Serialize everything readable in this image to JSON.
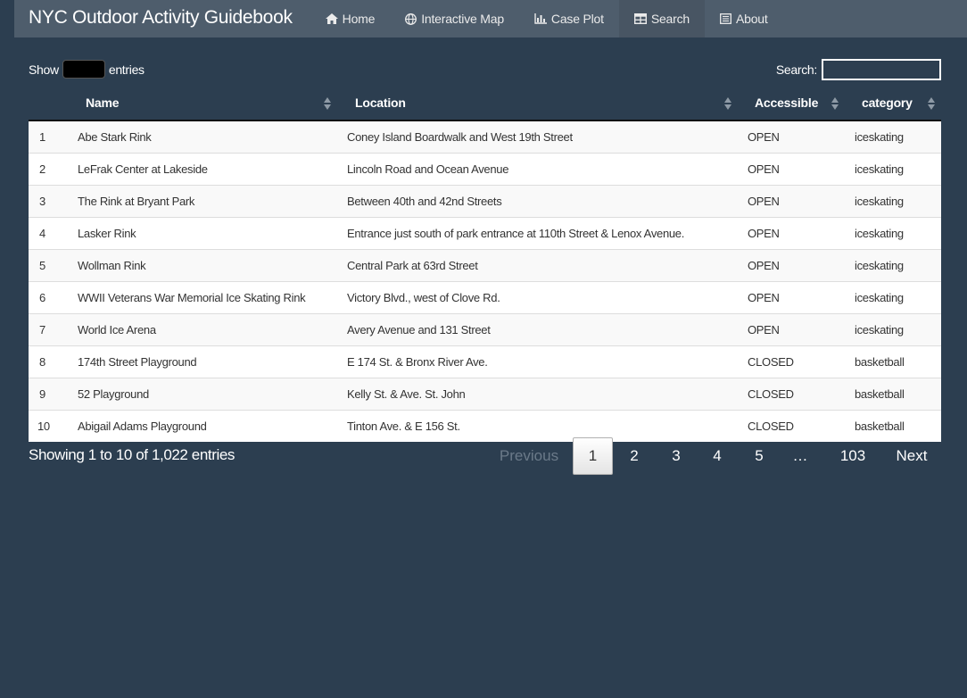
{
  "app": {
    "title": "NYC Outdoor Activity Guidebook"
  },
  "nav": [
    {
      "label": "Home",
      "icon": "home-icon"
    },
    {
      "label": "Interactive Map",
      "icon": "globe-icon"
    },
    {
      "label": "Case Plot",
      "icon": "bar-chart-icon"
    },
    {
      "label": "Search",
      "icon": "table-icon",
      "active": true
    },
    {
      "label": "About",
      "icon": "list-alt-icon"
    }
  ],
  "controls": {
    "show_label": "Show",
    "entries_label": "entries",
    "search_label": "Search:",
    "search_value": ""
  },
  "table": {
    "columns": [
      "Name",
      "Location",
      "Accessible",
      "category"
    ],
    "rows": [
      {
        "index": "1",
        "name": "Abe Stark Rink",
        "location": "Coney Island Boardwalk and West 19th Street",
        "accessible": "OPEN",
        "category": "iceskating"
      },
      {
        "index": "2",
        "name": "LeFrak Center at Lakeside",
        "location": "Lincoln Road and Ocean Avenue",
        "accessible": "OPEN",
        "category": "iceskating"
      },
      {
        "index": "3",
        "name": "The Rink at Bryant Park",
        "location": "Between 40th and 42nd Streets",
        "accessible": "OPEN",
        "category": "iceskating"
      },
      {
        "index": "4",
        "name": "Lasker Rink",
        "location": "Entrance just south of park entrance at 110th Street & Lenox Avenue.",
        "accessible": "OPEN",
        "category": "iceskating"
      },
      {
        "index": "5",
        "name": "Wollman Rink",
        "location": "Central Park at 63rd Street",
        "accessible": "OPEN",
        "category": "iceskating"
      },
      {
        "index": "6",
        "name": "WWII Veterans War Memorial Ice Skating Rink",
        "location": "Victory Blvd., west of Clove Rd.",
        "accessible": "OPEN",
        "category": "iceskating"
      },
      {
        "index": "7",
        "name": "World Ice Arena",
        "location": "Avery Avenue and 131 Street",
        "accessible": "OPEN",
        "category": "iceskating"
      },
      {
        "index": "8",
        "name": "174th Street Playground",
        "location": "E 174 St. & Bronx River Ave.",
        "accessible": "CLOSED",
        "category": "basketball"
      },
      {
        "index": "9",
        "name": "52 Playground",
        "location": "Kelly St. & Ave. St. John",
        "accessible": "CLOSED",
        "category": "basketball"
      },
      {
        "index": "10",
        "name": "Abigail Adams Playground",
        "location": "Tinton Ave. & E 156 St.",
        "accessible": "CLOSED",
        "category": "basketball"
      }
    ]
  },
  "footer": {
    "info": "Showing 1 to 10 of 1,022 entries",
    "pagination": {
      "previous": "Previous",
      "pages": [
        "1",
        "2",
        "3",
        "4",
        "5",
        "…",
        "103"
      ],
      "current": "1",
      "next": "Next"
    }
  },
  "colors": {
    "background": "#2c3e50",
    "navbar": "#4e5d6c",
    "nav_active": "#485563"
  }
}
